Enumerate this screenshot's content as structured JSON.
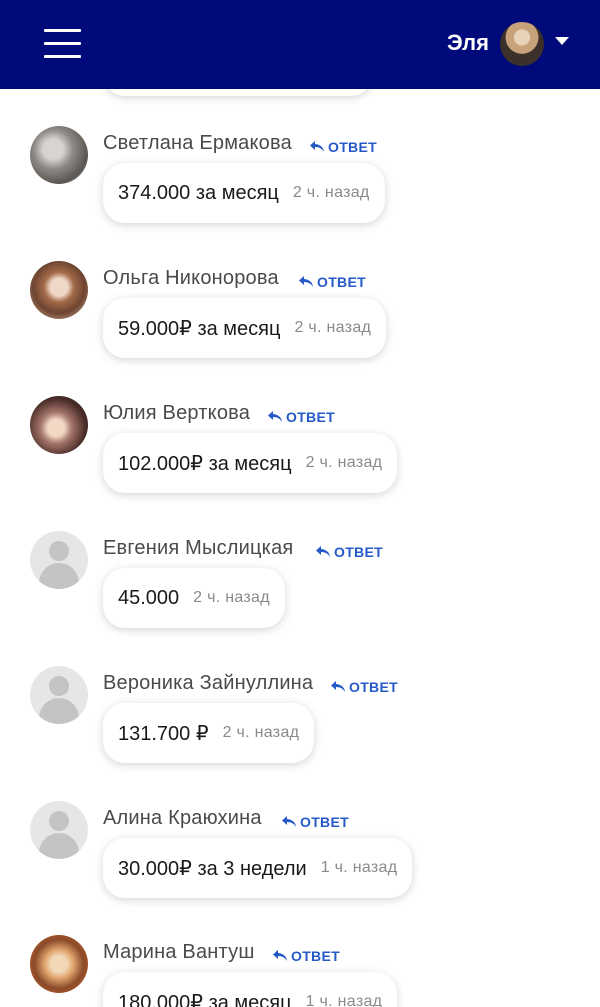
{
  "header": {
    "user_name": "Эля",
    "colors": {
      "bar": "#000a7a",
      "accent": "#2659c8"
    },
    "icons": [
      "hamburger-menu-icon",
      "caret-down-icon"
    ]
  },
  "reply_label": "ОТВЕТ",
  "comments": [
    {
      "author": "Светлана Ермакова",
      "text": "374.000 за месяц",
      "time": "2 ч. назад"
    },
    {
      "author": "Ольга Никонорова",
      "text": "59.000₽ за месяц",
      "time": "2 ч. назад"
    },
    {
      "author": "Юлия Верткова",
      "text": "102.000₽ за месяц",
      "time": "2 ч. назад"
    },
    {
      "author": "Евгения Мыслицкая",
      "text": "45.000",
      "time": "2 ч. назад"
    },
    {
      "author": "Вероника Зайнуллина",
      "text": "131.700 ₽",
      "time": "2 ч. назад"
    },
    {
      "author": "Алина Краюхина",
      "text": "30.000₽ за 3 недели",
      "time": "1 ч. назад"
    },
    {
      "author": "Марина Вантуш",
      "text": "180.000₽ за месяц",
      "time": "1 ч. назад"
    }
  ]
}
